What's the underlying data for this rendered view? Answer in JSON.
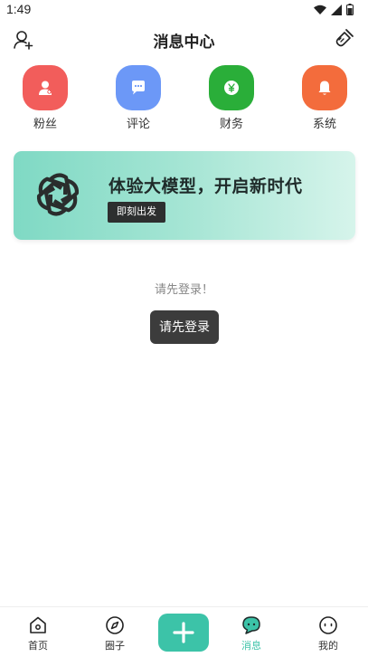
{
  "status": {
    "time": "1:49"
  },
  "header": {
    "title": "消息中心"
  },
  "quick_actions": [
    {
      "label": "粉丝",
      "icon": "user-icon",
      "color": "#f25d5b"
    },
    {
      "label": "评论",
      "icon": "comment-icon",
      "color": "#6c98f7"
    },
    {
      "label": "财务",
      "icon": "yen-icon",
      "color": "#2aae39"
    },
    {
      "label": "系统",
      "icon": "bell-icon",
      "color": "#f36c3c"
    }
  ],
  "banner": {
    "title": "体验大模型，开启新时代",
    "button_label": "即刻出发"
  },
  "login": {
    "hint": "请先登录！",
    "button_label": "请先登录"
  },
  "tabbar": {
    "items": [
      {
        "label": "首页",
        "icon": "home-icon"
      },
      {
        "label": "圈子",
        "icon": "compass-icon"
      },
      {
        "label": "消息",
        "icon": "chat-icon",
        "active": true
      },
      {
        "label": "我的",
        "icon": "face-icon"
      }
    ],
    "accent": "#3cc3a8"
  }
}
